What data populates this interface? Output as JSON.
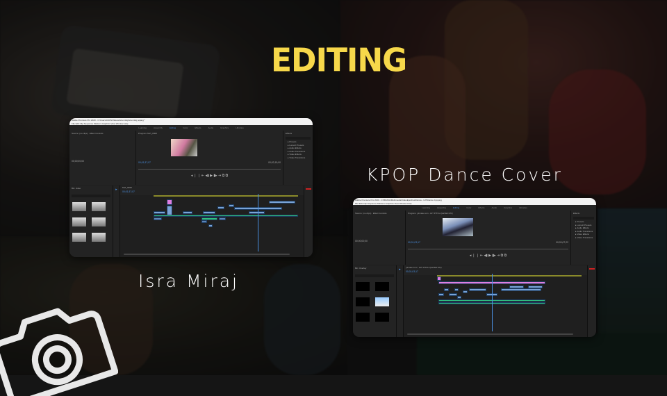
{
  "slide": {
    "title": "EDITING",
    "caption_left": "Isra Miraj",
    "caption_right": "KPOP Dance Cover",
    "accent": "#f7d84a"
  },
  "editors": [
    {
      "window_title": "Adobe Premiere Pro 2020 - C:\\Users\\ASUS\\Videos\\isra miraj\\isra miraj pojang *",
      "menu": "File  Edit  Clip  Sequence  Markers  Graphics  View  Window  Help",
      "workspaces": [
        "Learning",
        "Assembly",
        "Editing",
        "Color",
        "Effects",
        "Audio",
        "Graphics",
        "Libraries"
      ],
      "active_workspace": "Editing",
      "source_tab": "Source: (no clips)",
      "effect_controls": "Effect Controls",
      "program_tab": "Program: MVI_0008",
      "program_timecode": "00;01;37;07",
      "program_duration": "00;02;19;00",
      "source_timecode": "00;00;00;00",
      "effects_tab": "Effects",
      "effects_items": [
        "Presets",
        "Lumetri Presets",
        "Audio Effects",
        "Audio Transitions",
        "Video Effects",
        "Video Transitions"
      ],
      "project_tab": "Bin: video",
      "sequence_tab": "MVI_0008",
      "sequence_timecode": "00;01;37;07"
    },
    {
      "window_title": "Adobe Premiere Pro 2020 - C:\\BRAVA\\Multimedia\\VideoEpoches\\Dance - HIT\\Dance Cyojung",
      "menu": "File  Edit  Clip  Sequence  Markers  Graphics  View  Window  Help",
      "workspaces": [
        "Learning",
        "Assembly",
        "Editing",
        "Color",
        "Effects",
        "Audio",
        "Graphics",
        "Libraries"
      ],
      "active_workspace": "Editing",
      "source_tab": "Source: (no clips)",
      "effect_controls": "Effect Controls",
      "program_tab": "Program: y2mate.com - HIT PITCH (LEVEN MV)",
      "program_timecode": "00;01;03;17",
      "program_duration": "00;03;07;22",
      "source_timecode": "00;00;00;00",
      "effects_tab": "Effects",
      "effects_items": [
        "Presets",
        "Lumetri Presets",
        "Audio Effects",
        "Audio Transitions",
        "Video Effects",
        "Video Transitions"
      ],
      "project_tab": "Bin: Overlay",
      "sequence_tab": "y2mate.com - HIT PITCH (LEVEN MV)",
      "sequence_timecode": "00;01;03;17"
    }
  ]
}
